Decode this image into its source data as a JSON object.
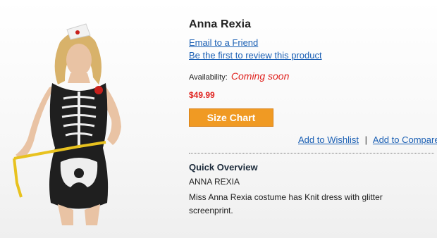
{
  "product": {
    "name": "Anna Rexia",
    "email_link": "Email to a Friend",
    "review_link": "Be the first to review this product",
    "availability_label": "Availability:",
    "availability_status": "Coming soon",
    "price": "$49.99",
    "size_chart_label": "Size Chart",
    "wishlist_label": "Add to Wishlist",
    "separator": "|",
    "compare_label": "Add to Compare"
  },
  "overview": {
    "heading": "Quick Overview",
    "sku": "ANNA REXIA",
    "description": "Miss Anna Rexia costume has Knit dress with glitter screenprint."
  },
  "colors": {
    "link": "#1a5fb4",
    "alert": "#e0231f",
    "button": "#f09a23"
  }
}
